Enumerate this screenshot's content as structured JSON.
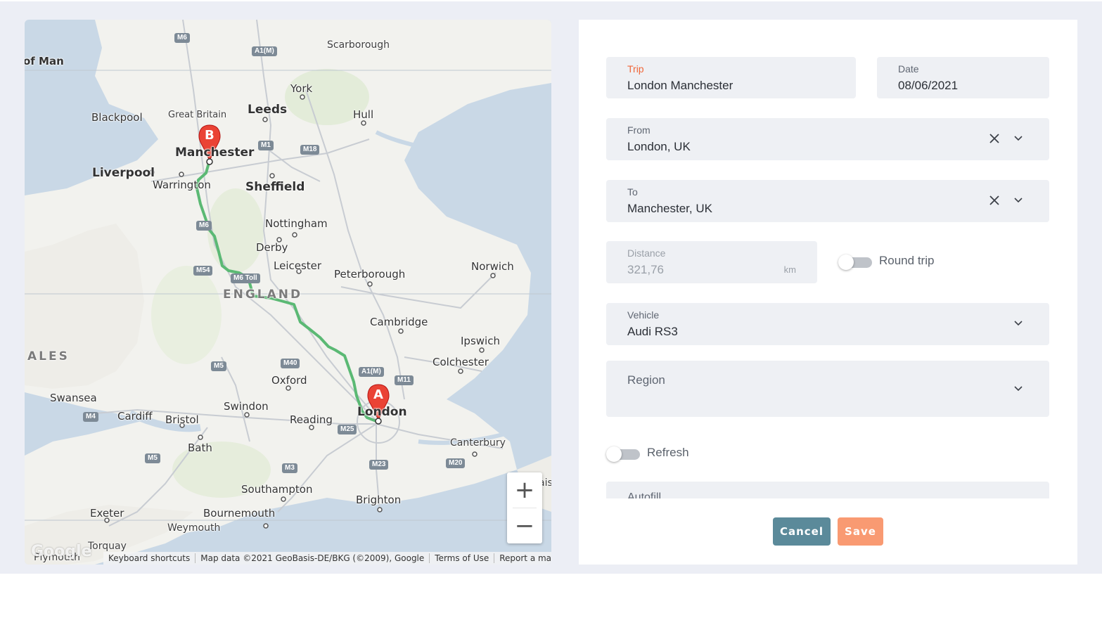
{
  "map": {
    "labels": {
      "isle_of_man": "of Man",
      "m6_north": "M6",
      "a1m_north": "A1(M)",
      "scarborough": "Scarborough",
      "york": "York",
      "blackpool": "Blackpool",
      "great_britain": "Great Britain",
      "leeds": "Leeds",
      "hull": "Hull",
      "manchester": "Manchester",
      "m1_north": "M1",
      "m18": "M18",
      "liverpool": "Liverpool",
      "warrington": "Warrington",
      "sheffield": "Sheffield",
      "m6_mid": "M6",
      "nottingham": "Nottingham",
      "derby": "Derby",
      "leicester": "Leicester",
      "peterborough": "Peterborough",
      "norwich": "Norwich",
      "m54": "M54",
      "m6_toll": "M6 Toll",
      "england": "ENGLAND",
      "cambridge": "Cambridge",
      "ipswich": "Ipswich",
      "wales": "ALES",
      "colchester": "Colchester",
      "m5_mid": "M5",
      "m40": "M40",
      "a1m_south": "A1(M)",
      "m11": "M11",
      "oxford": "Oxford",
      "swansea": "Swansea",
      "swindon": "Swindon",
      "london": "London",
      "m4": "M4",
      "cardiff": "Cardiff",
      "bristol": "Bristol",
      "reading": "Reading",
      "m25": "M25",
      "canterbury": "Canterbury",
      "bath": "Bath",
      "m5_south": "M5",
      "m23": "M23",
      "m20": "M20",
      "m3": "M3",
      "southampton": "Southampton",
      "brighton": "Brighton",
      "exeter": "Exeter",
      "bournemouth": "Bournemouth",
      "weymouth": "Weymouth",
      "torquay": "Torquay",
      "plymouth": "Plymouth",
      "calais_partial": "ais"
    },
    "markers": {
      "origin": "A",
      "destination": "B"
    },
    "zoom_in": "+",
    "zoom_out": "−",
    "google_logo": "Google",
    "attribution": {
      "shortcuts": "Keyboard shortcuts",
      "data": "Map data ©2021 GeoBasis-DE/BKG (©2009), Google",
      "terms": "Terms of Use",
      "report": "Report a map error"
    },
    "route_color": "#5bb974",
    "marker_color": "#ea4335"
  },
  "form": {
    "trip": {
      "label": "Trip",
      "value": "London Manchester"
    },
    "date": {
      "label": "Date",
      "value": "08/06/2021"
    },
    "from": {
      "label": "From",
      "value": "London, UK"
    },
    "to": {
      "label": "To",
      "value": "Manchester, UK"
    },
    "distance": {
      "label": "Distance",
      "value": "321,76",
      "unit": "km"
    },
    "round_trip": {
      "label": "Round trip",
      "on": false
    },
    "vehicle": {
      "label": "Vehicle",
      "value": "Audi RS3"
    },
    "region": {
      "label": "Region",
      "value": ""
    },
    "refresh": {
      "label": "Refresh",
      "on": false
    },
    "autofill": {
      "label": "Autofill"
    },
    "cancel_label": "Cancel",
    "save_label": "Save"
  },
  "colors": {
    "accent": "#f0673a",
    "cancel": "#5b8a9a",
    "save": "#f99a72",
    "field_bg": "#eef0f4"
  }
}
